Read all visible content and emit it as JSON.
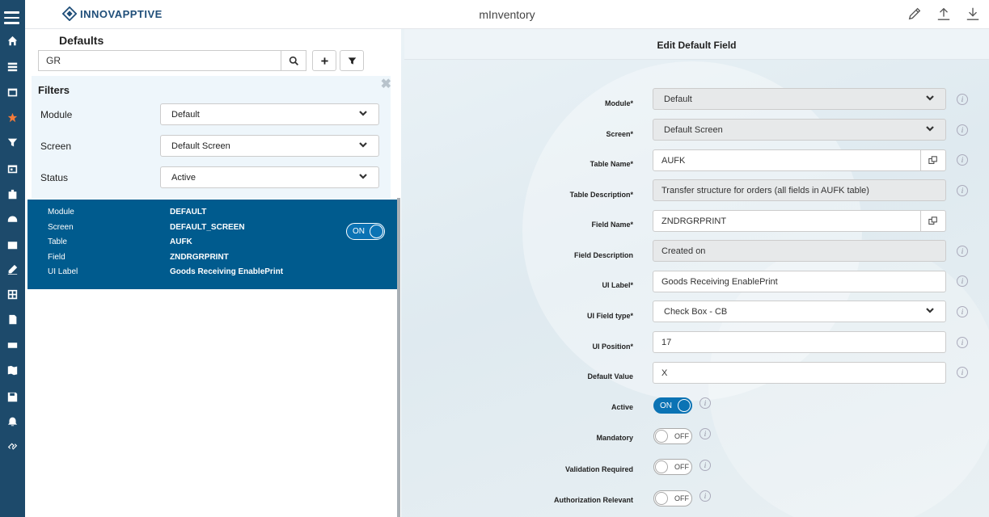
{
  "header": {
    "brand": "INNOVAPPTIVE",
    "app_title": "mInventory"
  },
  "left": {
    "title": "Defaults",
    "search": {
      "value": "GR"
    },
    "filters": {
      "title": "Filters",
      "module": {
        "label": "Module",
        "value": "Default"
      },
      "screen": {
        "label": "Screen",
        "value": "Default Screen"
      },
      "status": {
        "label": "Status",
        "value": "Active"
      }
    },
    "card": {
      "module_label": "Module",
      "module_value": "DEFAULT",
      "screen_label": "Screen",
      "screen_value": "DEFAULT_SCREEN",
      "table_label": "Table",
      "table_value": "AUFK",
      "field_label": "Field",
      "field_value": "ZNDRGRPRINT",
      "uilabel_label": "UI Label",
      "uilabel_value": "Goods Receiving EnablePrint",
      "toggle": "ON"
    }
  },
  "form": {
    "title": "Edit Default Field",
    "module": {
      "label": "Module*",
      "value": "Default"
    },
    "screen": {
      "label": "Screen*",
      "value": "Default Screen"
    },
    "table_name": {
      "label": "Table Name*",
      "value": "AUFK"
    },
    "table_desc": {
      "label": "Table Description*",
      "value": "Transfer structure for orders (all fields in AUFK table)"
    },
    "field_name": {
      "label": "Field Name*",
      "value": "ZNDRGRPRINT"
    },
    "field_desc": {
      "label": "Field Description",
      "value": "Created on"
    },
    "ui_label": {
      "label": "UI Label*",
      "value": "Goods Receiving EnablePrint"
    },
    "ui_type": {
      "label": "UI Field type*",
      "value": "Check Box - CB"
    },
    "ui_position": {
      "label": "UI Position*",
      "value": "17"
    },
    "default_value": {
      "label": "Default Value",
      "value": "X"
    },
    "active": {
      "label": "Active",
      "state": "ON"
    },
    "mandatory": {
      "label": "Mandatory",
      "state": "OFF"
    },
    "validation": {
      "label": "Validation Required",
      "state": "OFF"
    },
    "authorization": {
      "label": "Authorization Relevant",
      "state": "OFF"
    },
    "info_glyph": "i"
  },
  "colors": {
    "rail": "#1d4a6b",
    "accent": "#005b8e",
    "toggle_on": "#0b73b4"
  }
}
